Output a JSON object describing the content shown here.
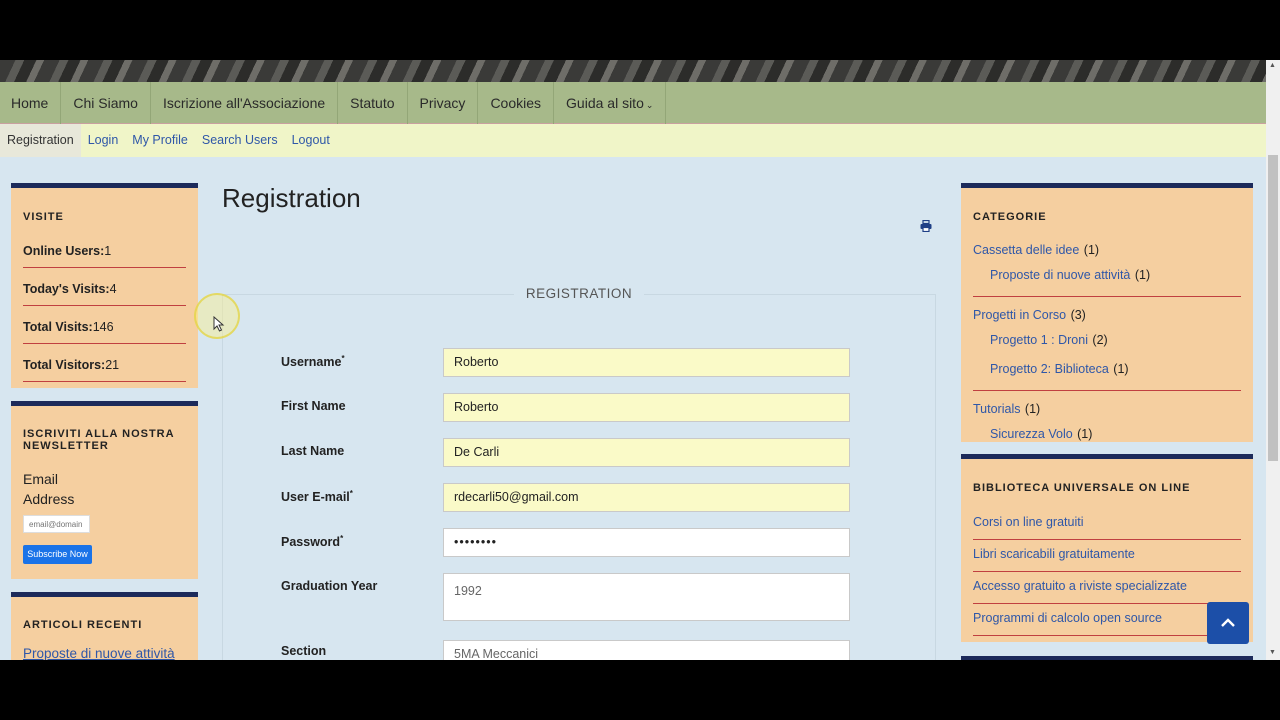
{
  "main_nav": [
    "Home",
    "Chi Siamo",
    "Iscrizione all'Associazione",
    "Statuto",
    "Privacy",
    "Cookies",
    "Guida al sito"
  ],
  "sub_nav": [
    "Registration",
    "Login",
    "My Profile",
    "Search Users",
    "Logout"
  ],
  "visits": {
    "title": "VISITE",
    "rows": [
      {
        "label": "Online Users:",
        "value": "1"
      },
      {
        "label": "Today's Visits:",
        "value": "4"
      },
      {
        "label": "Total Visits:",
        "value": "146"
      },
      {
        "label": "Total Visitors:",
        "value": "21"
      }
    ]
  },
  "newsletter": {
    "title": "ISCRIVITI ALLA NOSTRA NEWSLETTER",
    "email_label_1": "Email",
    "email_label_2": "Address",
    "placeholder": "email@domain",
    "button": "Subscribe Now"
  },
  "recent": {
    "title": "ARTICOLI RECENTI",
    "first": "Proposte di nuove attività"
  },
  "page": {
    "title": "Registration",
    "legend": "REGISTRATION"
  },
  "form": {
    "username_label": "Username",
    "username": "Roberto",
    "firstname_label": "First Name",
    "firstname": "Roberto",
    "lastname_label": "Last Name",
    "lastname": "De Carli",
    "email_label": "User E-mail",
    "email": "rdecarli50@gmail.com",
    "password_label": "Password",
    "password": "••••••••",
    "gradyear_label": "Graduation Year",
    "gradyear": "1992",
    "section_label": "Section",
    "section": "5MA Meccanici",
    "required": "*"
  },
  "categories": {
    "title": "CATEGORIE",
    "items": [
      {
        "name": "Cassetta delle idee",
        "count": "(1)",
        "level": 0
      },
      {
        "name": "Proposte di nuove attività",
        "count": "(1)",
        "level": 1
      },
      {
        "name": "Progetti in Corso",
        "count": "(3)",
        "level": 0
      },
      {
        "name": "Progetto 1 : Droni",
        "count": "(2)",
        "level": 1
      },
      {
        "name": "Progetto 2: Biblioteca",
        "count": "(1)",
        "level": 1
      },
      {
        "name": "Tutorials",
        "count": "(1)",
        "level": 0
      },
      {
        "name": "Sicurezza Volo",
        "count": "(1)",
        "level": 1
      }
    ]
  },
  "library": {
    "title": "BIBLIOTECA UNIVERSALE ON LINE",
    "links": [
      "Corsi on line gratuiti",
      "Libri scaricabili gratuitamente",
      "Accesso gratuito a riviste specializzate",
      "Programmi di calcolo open source"
    ]
  },
  "colors": {
    "nav": "#a7b98a",
    "subnav": "#f0f5c8",
    "module": "#f5cfa0",
    "accent": "#1c2a5a",
    "field": "#fafac8"
  }
}
